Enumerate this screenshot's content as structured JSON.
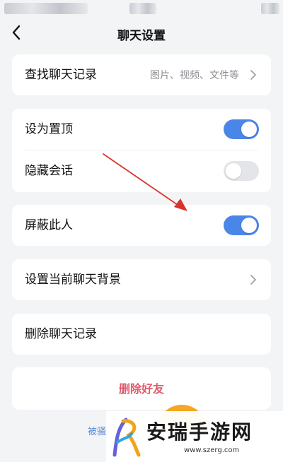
{
  "nav": {
    "title": "聊天设置"
  },
  "search_history": {
    "label": "查找聊天记录",
    "hint": "图片、视频、文件等"
  },
  "pin": {
    "label": "设为置顶",
    "enabled": true
  },
  "hide": {
    "label": "隐藏会话",
    "enabled": false
  },
  "block": {
    "label": "屏蔽此人",
    "enabled": true
  },
  "background": {
    "label": "设置当前聊天背景"
  },
  "clear_history": {
    "label": "删除聊天记录"
  },
  "delete_friend": {
    "label": "删除好友",
    "color": "#e05a6d"
  },
  "report": {
    "label": "被骚",
    "color": "#5b8bd9"
  },
  "watermark": {
    "name": "安瑞手游网",
    "url": "www.szerg.com"
  },
  "colors": {
    "toggle_on": "#4a86e8",
    "toggle_off": "#e4e5e8",
    "annotation_arrow": "#d9342b"
  },
  "icons": {
    "back": "chevron-left-icon",
    "chevron": "chevron-right-icon"
  }
}
